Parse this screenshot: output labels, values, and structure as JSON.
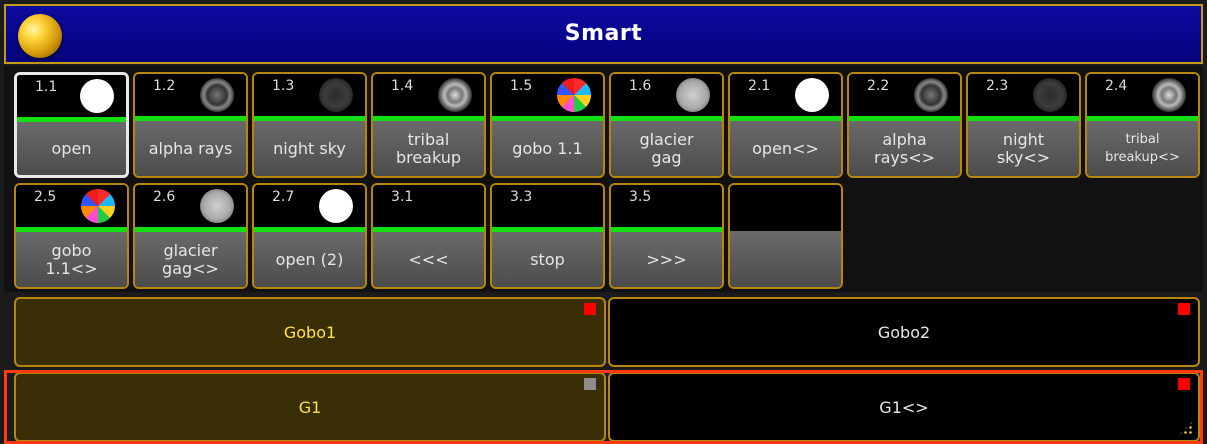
{
  "window": {
    "title": "Smart"
  },
  "cells": [
    {
      "num": "1.1",
      "label": "open",
      "gobo": "open-icon",
      "selected": true
    },
    {
      "num": "1.2",
      "label": "alpha rays",
      "gobo": "alpha-rays-icon"
    },
    {
      "num": "1.3",
      "label": "night sky",
      "gobo": "night-sky-icon"
    },
    {
      "num": "1.4",
      "label": "tribal\nbreakup",
      "gobo": "tribal-breakup-icon"
    },
    {
      "num": "1.5",
      "label": "gobo 1.1",
      "gobo": "gobo-1-1-icon"
    },
    {
      "num": "1.6",
      "label": "glacier\ngag",
      "gobo": "glacier-gag-icon"
    },
    {
      "num": "2.1",
      "label": "open<>",
      "gobo": "open-icon"
    },
    {
      "num": "2.2",
      "label": "alpha\nrays<>",
      "gobo": "alpha-rays-icon"
    },
    {
      "num": "2.3",
      "label": "night\nsky<>",
      "gobo": "night-sky-icon"
    },
    {
      "num": "2.4",
      "label": "tribal\nbreakup<>",
      "gobo": "tribal-breakup-icon"
    },
    {
      "num": "2.5",
      "label": "gobo\n1.1<>",
      "gobo": "gobo-1-1-icon"
    },
    {
      "num": "2.6",
      "label": "glacier\ngag<>",
      "gobo": "glacier-gag-icon"
    },
    {
      "num": "2.7",
      "label": "open (2)",
      "gobo": "open-icon"
    },
    {
      "num": "3.1",
      "label": "<<<",
      "gobo": ""
    },
    {
      "num": "3.3",
      "label": "stop",
      "gobo": ""
    },
    {
      "num": "3.5",
      "label": ">>>",
      "gobo": ""
    },
    {
      "num": "",
      "label": "",
      "gobo": ""
    }
  ],
  "rows": {
    "gobo1": "Gobo1",
    "gobo2": "Gobo2",
    "g1": "G1",
    "g1_cycle": "G1<>"
  },
  "colors": {
    "titlebar": "#05037e",
    "border": "#b8860b",
    "active_text": "#ffe14a",
    "selection_bar": "#12e012",
    "highlight": "#ff3b16"
  }
}
